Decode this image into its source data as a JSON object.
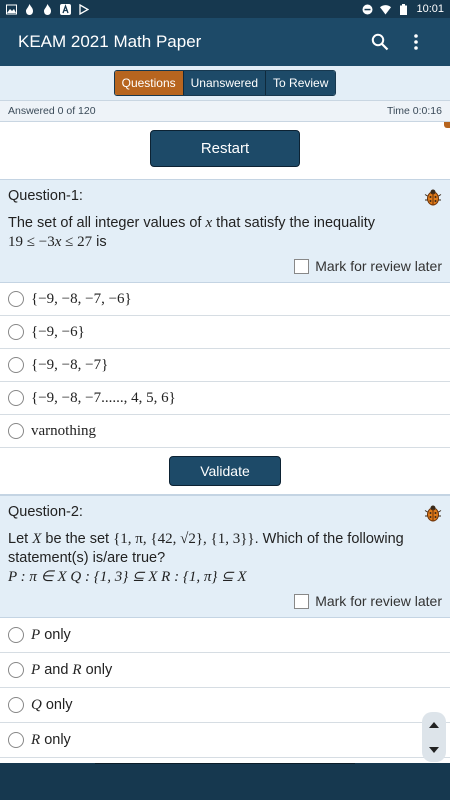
{
  "statusbar": {
    "time": "10:01",
    "left_icons": [
      "image-icon",
      "fire-icon",
      "fire-icon",
      "a-icon",
      "play-icon"
    ],
    "right_icons": [
      "do-not-disturb-icon",
      "wifi-icon",
      "battery-icon"
    ]
  },
  "appbar": {
    "title": "KEAM 2021 Math Paper",
    "actions": [
      "search-icon",
      "more-vert-icon"
    ]
  },
  "tabs": [
    {
      "label": "Questions",
      "active": true
    },
    {
      "label": "Unanswered",
      "active": false
    },
    {
      "label": "To Review",
      "active": false
    }
  ],
  "info": {
    "answered": "Answered 0 of 120",
    "time": "Time 0:0:16"
  },
  "restart_label": "Restart",
  "review_label": "Mark for review later",
  "validate_label": "Validate",
  "questions": [
    {
      "title": "Question-1:",
      "text_line1_a": "The set of all integer values of ",
      "text_line1_var": "x",
      "text_line1_b": " that satisfy the inequality",
      "text_line2_math": "19 ≤ −3",
      "text_line2_var": "x",
      "text_line2_math2": " ≤ 27",
      "text_line2_b": " is",
      "options": [
        "{−9, −8, −7, −6}",
        "{−9, −6}",
        "{−9, −8, −7}",
        "{−9, −8, −7......, 4, 5, 6}",
        "varnothing"
      ]
    },
    {
      "title": "Question-2:",
      "text_a": "Let ",
      "text_var": "X",
      "text_b": "  be the set ",
      "text_set": "{1, π, {42, √2}, {1, 3}}",
      "text_c": ". Which of the following",
      "text_line2": "statement(s) is/are true?",
      "text_line3": "P : π ∈ X    Q : {1, 3} ⊆ X     R : {1, π} ⊆ X",
      "options": [
        {
          "var": "P",
          "text": " only"
        },
        {
          "var": "P",
          "mid": " and ",
          "var2": "R",
          "text": " only"
        },
        {
          "var": "Q",
          "text": " only"
        },
        {
          "var": "R",
          "text": " only"
        }
      ]
    }
  ],
  "colors": {
    "appbar": "#1d4a68",
    "statusbar": "#16384f",
    "active_tab": "#b7651f",
    "question_bg": "#e3eef7"
  }
}
